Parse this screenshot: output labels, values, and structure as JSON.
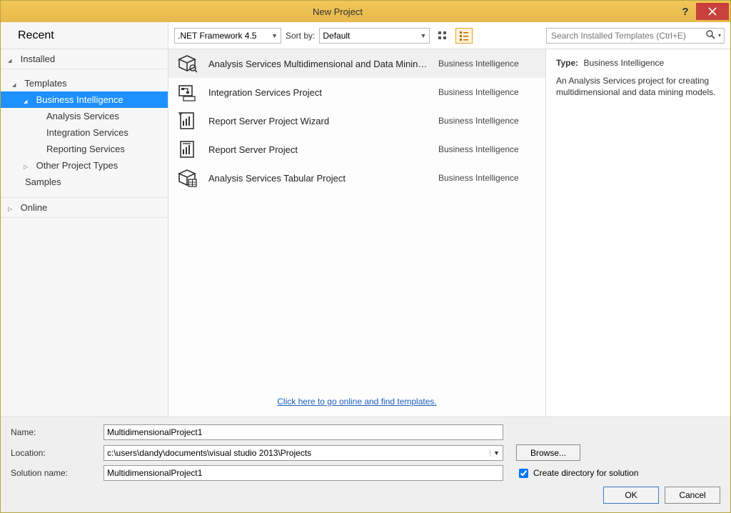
{
  "window": {
    "title": "New Project"
  },
  "nav": {
    "recent": "Recent",
    "installed": "Installed",
    "templates": "Templates",
    "bi": "Business Intelligence",
    "as": "Analysis Services",
    "is": "Integration Services",
    "rs": "Reporting Services",
    "other": "Other Project Types",
    "samples": "Samples",
    "online": "Online"
  },
  "toolbar": {
    "framework": ".NET Framework 4.5",
    "sortby_label": "Sort by:",
    "sortby_value": "Default",
    "search_placeholder": "Search Installed Templates (Ctrl+E)"
  },
  "templates": [
    {
      "name": "Analysis Services Multidimensional and Data Minin…",
      "category": "Business Intelligence",
      "icon": "cube"
    },
    {
      "name": "Integration Services Project",
      "category": "Business Intelligence",
      "icon": "ssis"
    },
    {
      "name": "Report Server Project Wizard",
      "category": "Business Intelligence",
      "icon": "wizard"
    },
    {
      "name": "Report Server Project",
      "category": "Business Intelligence",
      "icon": "report"
    },
    {
      "name": "Analysis Services Tabular Project",
      "category": "Business Intelligence",
      "icon": "tabular"
    }
  ],
  "online_link": "Click here to go online and find templates.",
  "description": {
    "type_label": "Type:",
    "type_value": "Business Intelligence",
    "text": "An Analysis Services project for creating multidimensional and data mining models."
  },
  "form": {
    "name_label": "Name:",
    "name_value": "MultidimensionalProject1",
    "location_label": "Location:",
    "location_value": "c:\\users\\dandy\\documents\\visual studio 2013\\Projects",
    "browse_label": "Browse...",
    "solution_label": "Solution name:",
    "solution_value": "MultidimensionalProject1",
    "createdir_label": "Create directory for solution",
    "ok": "OK",
    "cancel": "Cancel"
  }
}
